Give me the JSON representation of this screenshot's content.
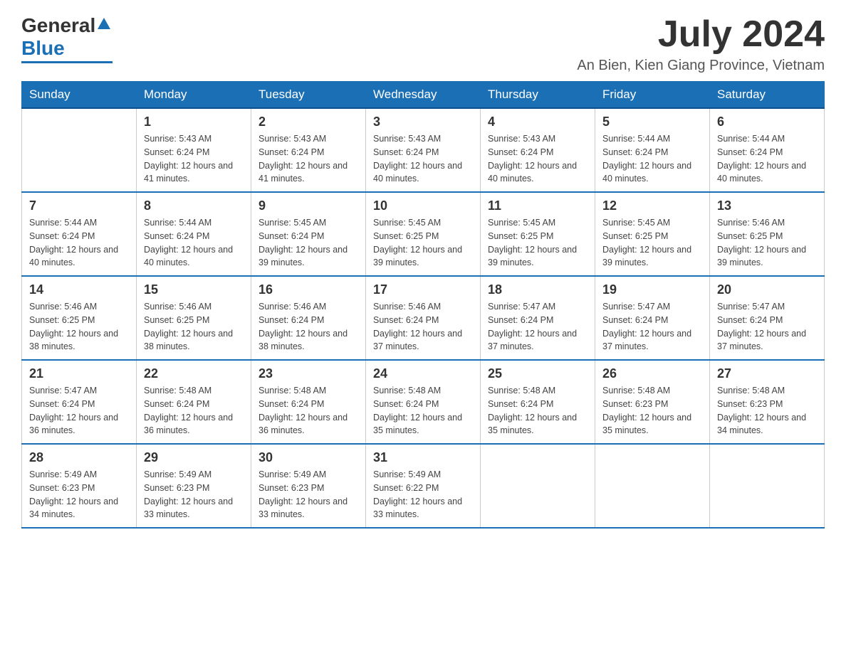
{
  "logo": {
    "general": "General",
    "blue": "Blue"
  },
  "header": {
    "month": "July 2024",
    "location": "An Bien, Kien Giang Province, Vietnam"
  },
  "weekdays": [
    "Sunday",
    "Monday",
    "Tuesday",
    "Wednesday",
    "Thursday",
    "Friday",
    "Saturday"
  ],
  "weeks": [
    [
      {
        "day": "",
        "sunrise": "",
        "sunset": "",
        "daylight": ""
      },
      {
        "day": "1",
        "sunrise": "Sunrise: 5:43 AM",
        "sunset": "Sunset: 6:24 PM",
        "daylight": "Daylight: 12 hours and 41 minutes."
      },
      {
        "day": "2",
        "sunrise": "Sunrise: 5:43 AM",
        "sunset": "Sunset: 6:24 PM",
        "daylight": "Daylight: 12 hours and 41 minutes."
      },
      {
        "day": "3",
        "sunrise": "Sunrise: 5:43 AM",
        "sunset": "Sunset: 6:24 PM",
        "daylight": "Daylight: 12 hours and 40 minutes."
      },
      {
        "day": "4",
        "sunrise": "Sunrise: 5:43 AM",
        "sunset": "Sunset: 6:24 PM",
        "daylight": "Daylight: 12 hours and 40 minutes."
      },
      {
        "day": "5",
        "sunrise": "Sunrise: 5:44 AM",
        "sunset": "Sunset: 6:24 PM",
        "daylight": "Daylight: 12 hours and 40 minutes."
      },
      {
        "day": "6",
        "sunrise": "Sunrise: 5:44 AM",
        "sunset": "Sunset: 6:24 PM",
        "daylight": "Daylight: 12 hours and 40 minutes."
      }
    ],
    [
      {
        "day": "7",
        "sunrise": "Sunrise: 5:44 AM",
        "sunset": "Sunset: 6:24 PM",
        "daylight": "Daylight: 12 hours and 40 minutes."
      },
      {
        "day": "8",
        "sunrise": "Sunrise: 5:44 AM",
        "sunset": "Sunset: 6:24 PM",
        "daylight": "Daylight: 12 hours and 40 minutes."
      },
      {
        "day": "9",
        "sunrise": "Sunrise: 5:45 AM",
        "sunset": "Sunset: 6:24 PM",
        "daylight": "Daylight: 12 hours and 39 minutes."
      },
      {
        "day": "10",
        "sunrise": "Sunrise: 5:45 AM",
        "sunset": "Sunset: 6:25 PM",
        "daylight": "Daylight: 12 hours and 39 minutes."
      },
      {
        "day": "11",
        "sunrise": "Sunrise: 5:45 AM",
        "sunset": "Sunset: 6:25 PM",
        "daylight": "Daylight: 12 hours and 39 minutes."
      },
      {
        "day": "12",
        "sunrise": "Sunrise: 5:45 AM",
        "sunset": "Sunset: 6:25 PM",
        "daylight": "Daylight: 12 hours and 39 minutes."
      },
      {
        "day": "13",
        "sunrise": "Sunrise: 5:46 AM",
        "sunset": "Sunset: 6:25 PM",
        "daylight": "Daylight: 12 hours and 39 minutes."
      }
    ],
    [
      {
        "day": "14",
        "sunrise": "Sunrise: 5:46 AM",
        "sunset": "Sunset: 6:25 PM",
        "daylight": "Daylight: 12 hours and 38 minutes."
      },
      {
        "day": "15",
        "sunrise": "Sunrise: 5:46 AM",
        "sunset": "Sunset: 6:25 PM",
        "daylight": "Daylight: 12 hours and 38 minutes."
      },
      {
        "day": "16",
        "sunrise": "Sunrise: 5:46 AM",
        "sunset": "Sunset: 6:24 PM",
        "daylight": "Daylight: 12 hours and 38 minutes."
      },
      {
        "day": "17",
        "sunrise": "Sunrise: 5:46 AM",
        "sunset": "Sunset: 6:24 PM",
        "daylight": "Daylight: 12 hours and 37 minutes."
      },
      {
        "day": "18",
        "sunrise": "Sunrise: 5:47 AM",
        "sunset": "Sunset: 6:24 PM",
        "daylight": "Daylight: 12 hours and 37 minutes."
      },
      {
        "day": "19",
        "sunrise": "Sunrise: 5:47 AM",
        "sunset": "Sunset: 6:24 PM",
        "daylight": "Daylight: 12 hours and 37 minutes."
      },
      {
        "day": "20",
        "sunrise": "Sunrise: 5:47 AM",
        "sunset": "Sunset: 6:24 PM",
        "daylight": "Daylight: 12 hours and 37 minutes."
      }
    ],
    [
      {
        "day": "21",
        "sunrise": "Sunrise: 5:47 AM",
        "sunset": "Sunset: 6:24 PM",
        "daylight": "Daylight: 12 hours and 36 minutes."
      },
      {
        "day": "22",
        "sunrise": "Sunrise: 5:48 AM",
        "sunset": "Sunset: 6:24 PM",
        "daylight": "Daylight: 12 hours and 36 minutes."
      },
      {
        "day": "23",
        "sunrise": "Sunrise: 5:48 AM",
        "sunset": "Sunset: 6:24 PM",
        "daylight": "Daylight: 12 hours and 36 minutes."
      },
      {
        "day": "24",
        "sunrise": "Sunrise: 5:48 AM",
        "sunset": "Sunset: 6:24 PM",
        "daylight": "Daylight: 12 hours and 35 minutes."
      },
      {
        "day": "25",
        "sunrise": "Sunrise: 5:48 AM",
        "sunset": "Sunset: 6:24 PM",
        "daylight": "Daylight: 12 hours and 35 minutes."
      },
      {
        "day": "26",
        "sunrise": "Sunrise: 5:48 AM",
        "sunset": "Sunset: 6:23 PM",
        "daylight": "Daylight: 12 hours and 35 minutes."
      },
      {
        "day": "27",
        "sunrise": "Sunrise: 5:48 AM",
        "sunset": "Sunset: 6:23 PM",
        "daylight": "Daylight: 12 hours and 34 minutes."
      }
    ],
    [
      {
        "day": "28",
        "sunrise": "Sunrise: 5:49 AM",
        "sunset": "Sunset: 6:23 PM",
        "daylight": "Daylight: 12 hours and 34 minutes."
      },
      {
        "day": "29",
        "sunrise": "Sunrise: 5:49 AM",
        "sunset": "Sunset: 6:23 PM",
        "daylight": "Daylight: 12 hours and 33 minutes."
      },
      {
        "day": "30",
        "sunrise": "Sunrise: 5:49 AM",
        "sunset": "Sunset: 6:23 PM",
        "daylight": "Daylight: 12 hours and 33 minutes."
      },
      {
        "day": "31",
        "sunrise": "Sunrise: 5:49 AM",
        "sunset": "Sunset: 6:22 PM",
        "daylight": "Daylight: 12 hours and 33 minutes."
      },
      {
        "day": "",
        "sunrise": "",
        "sunset": "",
        "daylight": ""
      },
      {
        "day": "",
        "sunrise": "",
        "sunset": "",
        "daylight": ""
      },
      {
        "day": "",
        "sunrise": "",
        "sunset": "",
        "daylight": ""
      }
    ]
  ]
}
